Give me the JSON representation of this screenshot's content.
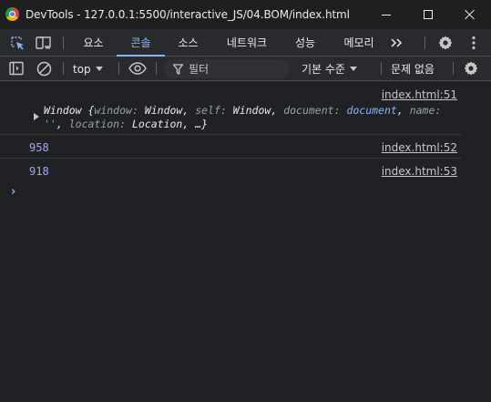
{
  "window": {
    "title": "DevTools - 127.0.0.1:5500/interactive_JS/04.BOM/index.html",
    "controls": {
      "minimize": "minimize",
      "maximize": "maximize",
      "close": "close"
    }
  },
  "tabs": [
    {
      "label": "요소",
      "active": false
    },
    {
      "label": "콘솔",
      "active": true
    },
    {
      "label": "소스",
      "active": false
    },
    {
      "label": "네트워크",
      "active": false
    },
    {
      "label": "성능",
      "active": false
    },
    {
      "label": "메모리",
      "active": false
    }
  ],
  "tabs_more": "»",
  "console_toolbar": {
    "context": "top",
    "filter_placeholder": "필터",
    "levels": "기본 수준",
    "issues": "문제 없음"
  },
  "messages": [
    {
      "type": "object",
      "source": "index.html:51",
      "object_name": "Window",
      "props": [
        {
          "key": "window",
          "value": "Window"
        },
        {
          "key": "self",
          "value": "Window"
        },
        {
          "key": "document",
          "value": "document"
        },
        {
          "key": "name",
          "value": "''"
        },
        {
          "key": "location",
          "value": "Location"
        }
      ],
      "ellipsis": "…}"
    },
    {
      "type": "number",
      "value": "958",
      "source": "index.html:52"
    },
    {
      "type": "number",
      "value": "918",
      "source": "index.html:53"
    }
  ],
  "prompt_symbol": "›",
  "colors": {
    "background": "#202124",
    "toolbar": "#292a2d",
    "accent": "#8ab4f8",
    "number": "#a3a3ff"
  }
}
